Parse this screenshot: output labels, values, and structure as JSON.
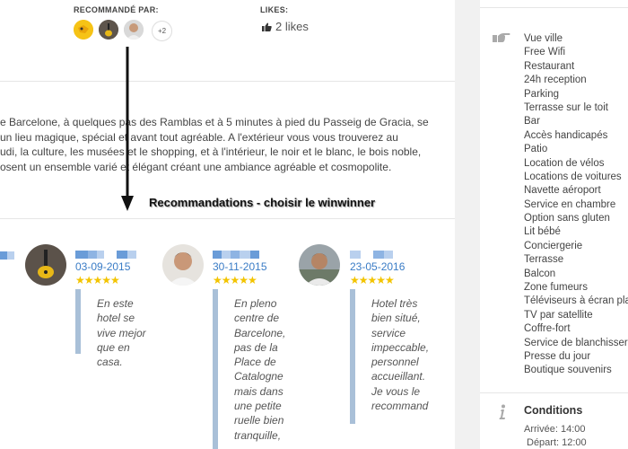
{
  "recommended": {
    "label": "RECOMMANDÉ PAR:",
    "more_count": "+2"
  },
  "likes": {
    "label": "LIKES:",
    "count_text": "2 likes"
  },
  "description": [
    "e Barcelone, à quelques pas des Ramblas et à 5 minutes à pied du Passeig de Gracia, se",
    "un lieu magique, spécial et avant tout agréable. A l'extérieur vous vous trouverez au",
    "udi, la culture, les musées et le shopping, et à l'intérieur, le noir et le blanc, le bois noble,",
    "osent un ensemble varié et élégant créant une ambiance agréable et cosmopolite."
  ],
  "annotation": "Recommandations - choisir le winwinner",
  "reviews": [
    {
      "date": "03-09-2015",
      "stars": "★★★★★",
      "lines": [
        "En este",
        "hotel se",
        "vive mejor",
        "que en",
        "casa."
      ]
    },
    {
      "date": "30-11-2015",
      "stars": "★★★★★",
      "lines": [
        "En pleno",
        "centre de",
        "Barcelone,",
        "pas de la",
        "Place de",
        "Catalogne",
        "mais dans",
        "une petite",
        "ruelle bien",
        "tranquille,"
      ]
    },
    {
      "date": "23-05-2016",
      "stars": "★★★★★",
      "lines": [
        "Hotel très",
        "bien situé,",
        "service",
        "impeccable,",
        "personnel",
        "accueillant.",
        "Je vous le",
        "recommand"
      ]
    }
  ],
  "services": [
    "Vue ville",
    "Free Wifi",
    "Restaurant",
    "24h reception",
    "Parking",
    "Terrasse sur le toit",
    "Bar",
    "Accès handicapés",
    "Patio",
    "Location de vélos",
    "Locations de voitures",
    "Navette aéroport",
    "Service en chambre",
    "Option sans gluten",
    "Lit bébé",
    "Conciergerie",
    "Terrasse",
    "Balcon",
    "Zone fumeurs",
    "Téléviseurs à écran plat",
    "TV par satellite",
    "Coffre-fort",
    "Service de blanchisserie",
    "Presse du jour",
    "Boutique souvenirs"
  ],
  "conditions": {
    "title": "Conditions",
    "arrival": "Arrivée: 14:00",
    "departure": "Départ: 12:00"
  },
  "colors": {
    "link_blue": "#3a7cc6",
    "star_gold": "#f3c400",
    "quote_bar": "#a9c0d8",
    "sidebar_bg": "#f1f1f1"
  },
  "icons": {
    "likes": "thumbs-up-icon",
    "services": "pointing-hand-icon",
    "conditions": "info-icon"
  }
}
